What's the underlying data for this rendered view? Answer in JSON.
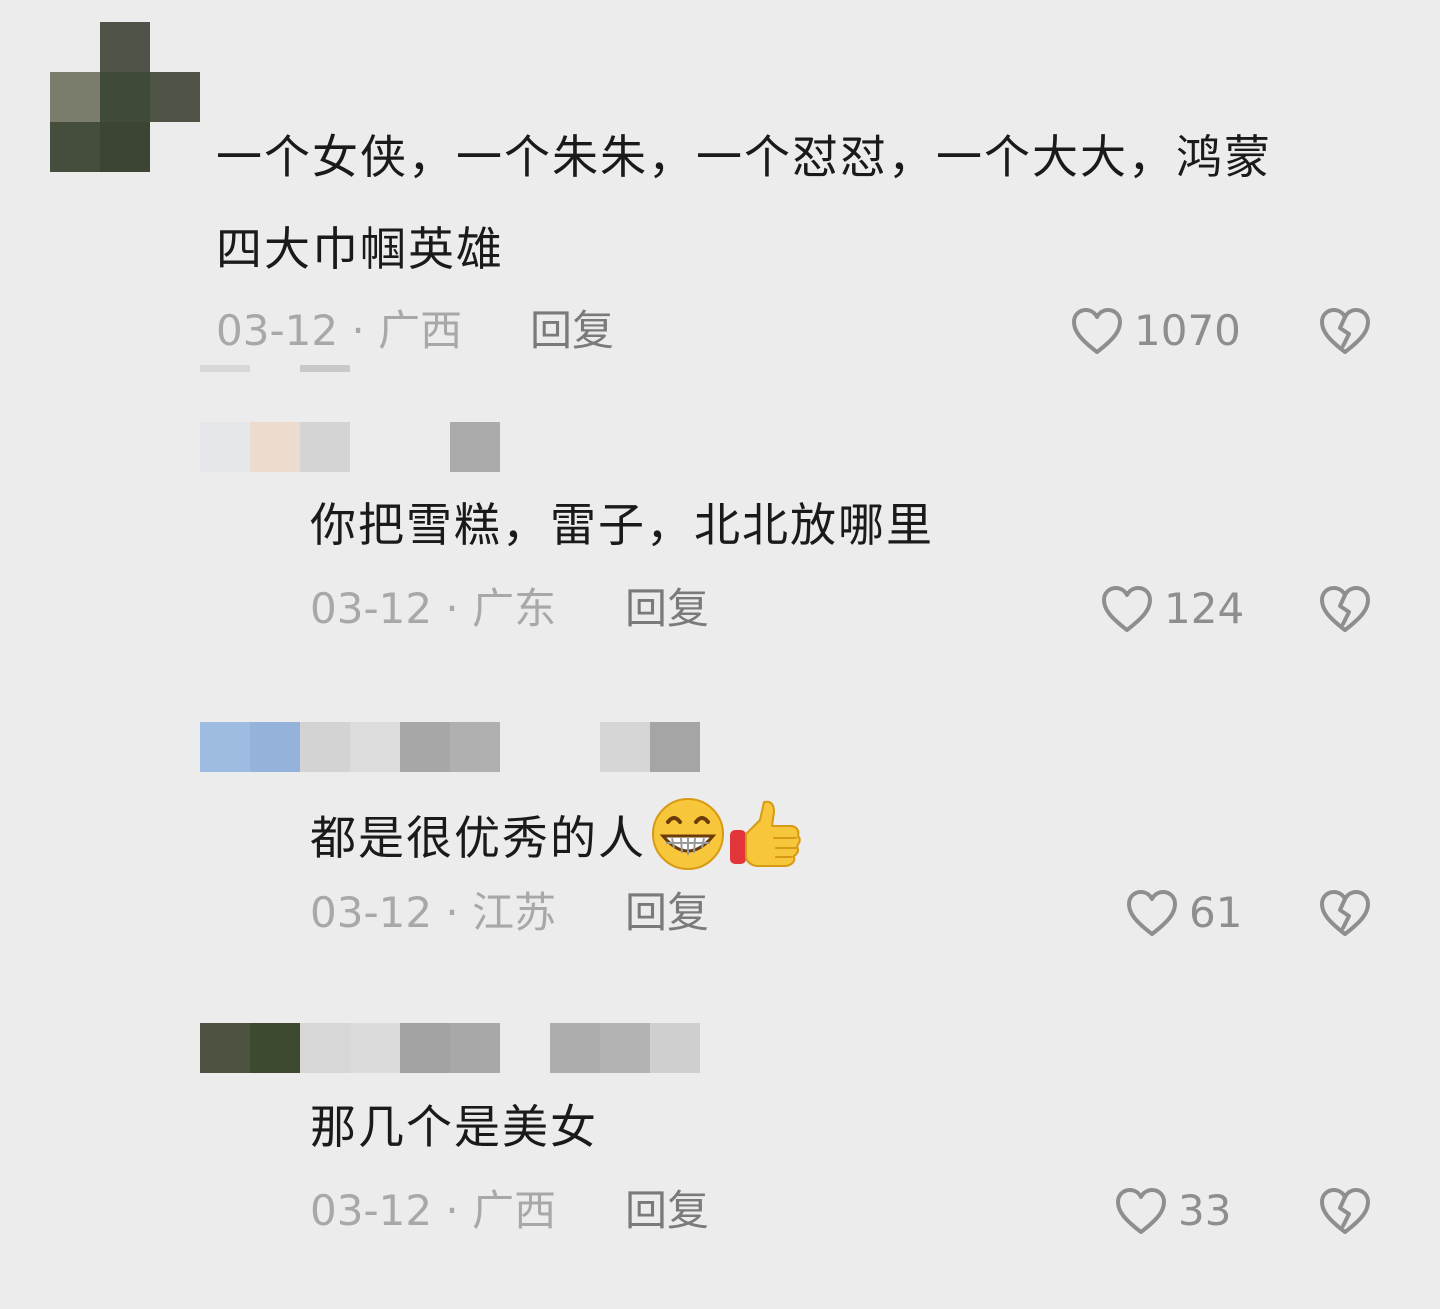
{
  "comments": [
    {
      "text": "一个女侠，一个朱朱，一个怼怼，一个大大，鸿蒙",
      "text_line2": "四大巾帼英雄",
      "meta": "03-12 · 广西",
      "reply": "回复",
      "likes": "1070"
    },
    {
      "text": "你把雪糕，雷子，北北放哪里",
      "meta": "03-12 · 广东",
      "reply": "回复",
      "likes": "124"
    },
    {
      "text": "都是很优秀的人",
      "emojis": [
        "grin-emoji",
        "thumbs-up-emoji"
      ],
      "meta": "03-12 · 江苏",
      "reply": "回复",
      "likes": "61"
    },
    {
      "text": "那几个是美女",
      "meta": "03-12 · 广西",
      "reply": "回复",
      "likes": "33"
    }
  ],
  "colors": {
    "background": "#ececec",
    "text": "#1a1a1a",
    "meta": "#a8a8a8",
    "reply": "#7a7a7a",
    "icon": "#8e8e8e"
  }
}
